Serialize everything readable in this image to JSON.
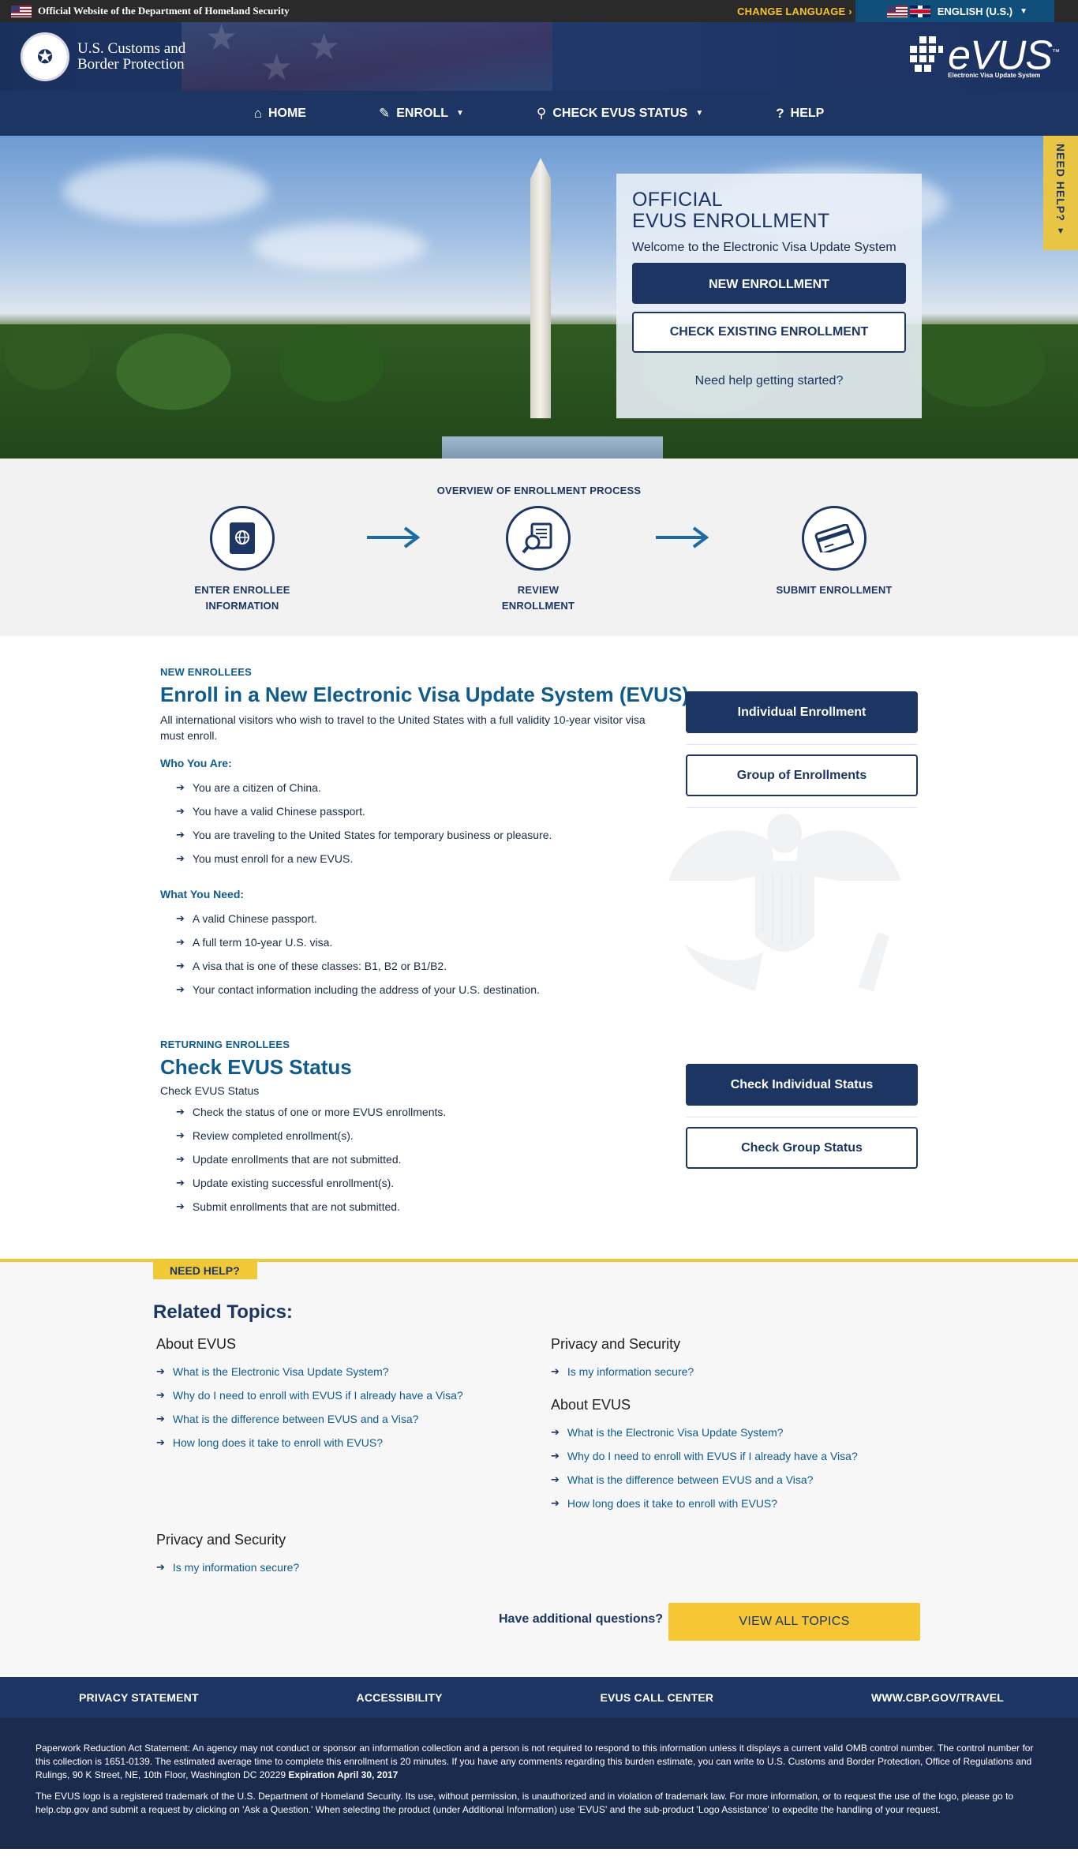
{
  "topbar": {
    "official": "Official Website of the Department of Homeland Security",
    "change_language": "CHANGE LANGUAGE",
    "change_language_arrow": "›",
    "language": "ENGLISH (U.S.)"
  },
  "header": {
    "agency_line1": "U.S. Customs and",
    "agency_line2": "Border Protection",
    "evus_word": "eVUS",
    "evus_tm": "™",
    "evus_tagline": "Electronic Visa Update System"
  },
  "nav": {
    "home": "HOME",
    "enroll": "ENROLL",
    "check_status": "CHECK EVUS STATUS",
    "help": "HELP"
  },
  "hero": {
    "title_line1": "OFFICIAL",
    "title_line2": "EVUS ENROLLMENT",
    "welcome": "Welcome to the Electronic Visa Update System",
    "new_enrollment": "NEW ENROLLMENT",
    "check_existing": "CHECK EXISTING ENROLLMENT",
    "help_link": "Need help getting started?",
    "need_help_tab": "NEED HELP?"
  },
  "overview": {
    "title": "OVERVIEW OF ENROLLMENT PROCESS",
    "steps": [
      {
        "line1": "ENTER ENROLLEE",
        "line2": "INFORMATION"
      },
      {
        "line1": "REVIEW",
        "line2": "ENROLLMENT"
      },
      {
        "line1": "SUBMIT ENROLLMENT",
        "line2": ""
      }
    ]
  },
  "new_enrollees": {
    "eyebrow": "NEW ENROLLEES",
    "title": "Enroll in a New Electronic Visa Update System (EVUS)",
    "lead": "All international visitors who wish to travel to the United States with a full validity 10-year visitor visa must enroll.",
    "who_title": "Who You Are:",
    "who": [
      "You are a citizen of China.",
      "You have a valid Chinese passport.",
      "You are traveling to the United States for temporary business or pleasure.",
      "You must enroll for a new EVUS."
    ],
    "need_title": "What You Need:",
    "need": [
      "A valid Chinese passport.",
      "A full term 10-year U.S. visa.",
      "A visa that is one of these classes: B1, B2 or B1/B2.",
      "Your contact information including the address of your U.S. destination."
    ],
    "btn_individual": "Individual Enrollment",
    "btn_group": "Group of Enrollments"
  },
  "returning": {
    "eyebrow": "RETURNING ENROLLEES",
    "title": "Check EVUS Status",
    "lead": "Check EVUS Status",
    "items": [
      "Check the status of one or more EVUS enrollments.",
      "Review completed enrollment(s).",
      "Update enrollments that are not submitted.",
      "Update existing successful enrollment(s).",
      "Submit enrollments that are not submitted."
    ],
    "btn_individual": "Check Individual Status",
    "btn_group": "Check Group Status"
  },
  "help": {
    "tag": "NEED HELP?",
    "title": "Related Topics:",
    "col1_title": "About EVUS",
    "col1": [
      "What is the Electronic Visa Update System?",
      "Why do I need to enroll with EVUS if I already have a Visa?",
      "What is the difference between EVUS and a Visa?",
      "How long does it take to enroll with EVUS?"
    ],
    "col2_title": "Privacy and Security",
    "col2": [
      "Is my information secure?"
    ],
    "col3_title": "About EVUS",
    "col3": [
      "What is the Electronic Visa Update System?",
      "Why do I need to enroll with EVUS if I already have a Visa?",
      "What is the difference between EVUS and a Visa?",
      "How long does it take to enroll with EVUS?"
    ],
    "col4_title": "Privacy and Security",
    "col4": [
      "Is my information secure?"
    ],
    "questions": "Have additional questions?",
    "view_all": "VIEW ALL TOPICS"
  },
  "footer": {
    "links": [
      "PRIVACY STATEMENT",
      "ACCESSIBILITY",
      "EVUS CALL CENTER",
      "WWW.CBP.GOV/TRAVEL"
    ],
    "paperwork": "Paperwork Reduction Act Statement: An agency may not conduct or sponsor an information collection and a person is not required to respond to this information unless it displays a current valid OMB control number. The control number for this collection is 1651-0139. The estimated average time to complete this enrollment is 20 minutes. If you have any comments regarding this burden estimate, you can write to U.S. Customs and Border Protection, Office of Regulations and Rulings, 90 K Street, NE, 10th Floor, Washington DC 20229",
    "expiration": "Expiration April 30, 2017",
    "trademark": "The EVUS logo is a registered trademark of the U.S. Department of Homeland Security. Its use, without permission, is unauthorized and in violation of trademark law. For more information, or to request the use of the logo, please go to help.cbp.gov and submit a request by clicking on 'Ask a Question.' When selecting the product (under Additional Information) use 'EVUS' and the sub-product 'Logo Assistance' to expedite the handling of your request."
  },
  "colors": {
    "navy": "#1d3563",
    "accent_blue": "#0f5b8e",
    "yellow": "#f6c634"
  }
}
